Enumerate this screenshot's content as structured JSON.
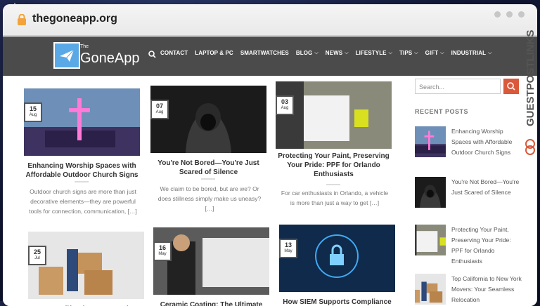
{
  "url": "thegoneapp.org",
  "site": {
    "logo_the": "The",
    "logo_name": "GoneApp"
  },
  "nav": [
    {
      "label": "CONTACT",
      "has_menu": false
    },
    {
      "label": "LAPTOP & PC",
      "has_menu": false
    },
    {
      "label": "SMARTWATCHES",
      "has_menu": false
    },
    {
      "label": "BLOG",
      "has_menu": true
    },
    {
      "label": "NEWS",
      "has_menu": true
    },
    {
      "label": "LIFESTYLE",
      "has_menu": true
    },
    {
      "label": "TIPS",
      "has_menu": true
    },
    {
      "label": "GIFT",
      "has_menu": true
    },
    {
      "label": "INDUSTRIAL",
      "has_menu": true
    }
  ],
  "posts": [
    {
      "day": "15",
      "month": "Aug",
      "title": "Enhancing Worship Spaces with Affordable Outdoor Church Signs",
      "excerpt": "Outdoor church signs are more than just decorative elements—they are powerful tools for connection, communication, […]"
    },
    {
      "day": "07",
      "month": "Aug",
      "title": "You're Not Bored—You're Just Scared of Silence",
      "excerpt": "We claim to be bored, but are we? Or does stillness simply make us uneasy? […]"
    },
    {
      "day": "03",
      "month": "Aug",
      "title": "Protecting Your Paint, Preserving Your Pride: PPF for Orlando Enthusiasts",
      "excerpt": "For car enthusiasts in Orlando, a vehicle is more than just a way to get […]"
    },
    {
      "day": "25",
      "month": "Jul",
      "title": "Top California to New York",
      "excerpt": ""
    },
    {
      "day": "16",
      "month": "May",
      "title": "Ceramic Coating: The Ultimate",
      "excerpt": ""
    },
    {
      "day": "13",
      "month": "May",
      "title": "How SIEM Supports Compliance",
      "excerpt": ""
    }
  ],
  "sidebar": {
    "search_placeholder": "Search...",
    "recent_heading": "RECENT POSTS",
    "recent": [
      "Enhancing Worship Spaces with Affordable Outdoor Church Signs",
      "You're Not Bored—You're Just Scared of Silence",
      "Protecting Your Paint, Preserving Your Pride: PPF for Orlando Enthusiasts",
      "Top California to New York Movers: Your Seamless Relocation"
    ]
  },
  "watermark": "GUESTPOSTLINKS",
  "colors": {
    "nav_bg": "#4b4b4b",
    "accent": "#d9593a",
    "logo_blue": "#5aa9e6"
  }
}
